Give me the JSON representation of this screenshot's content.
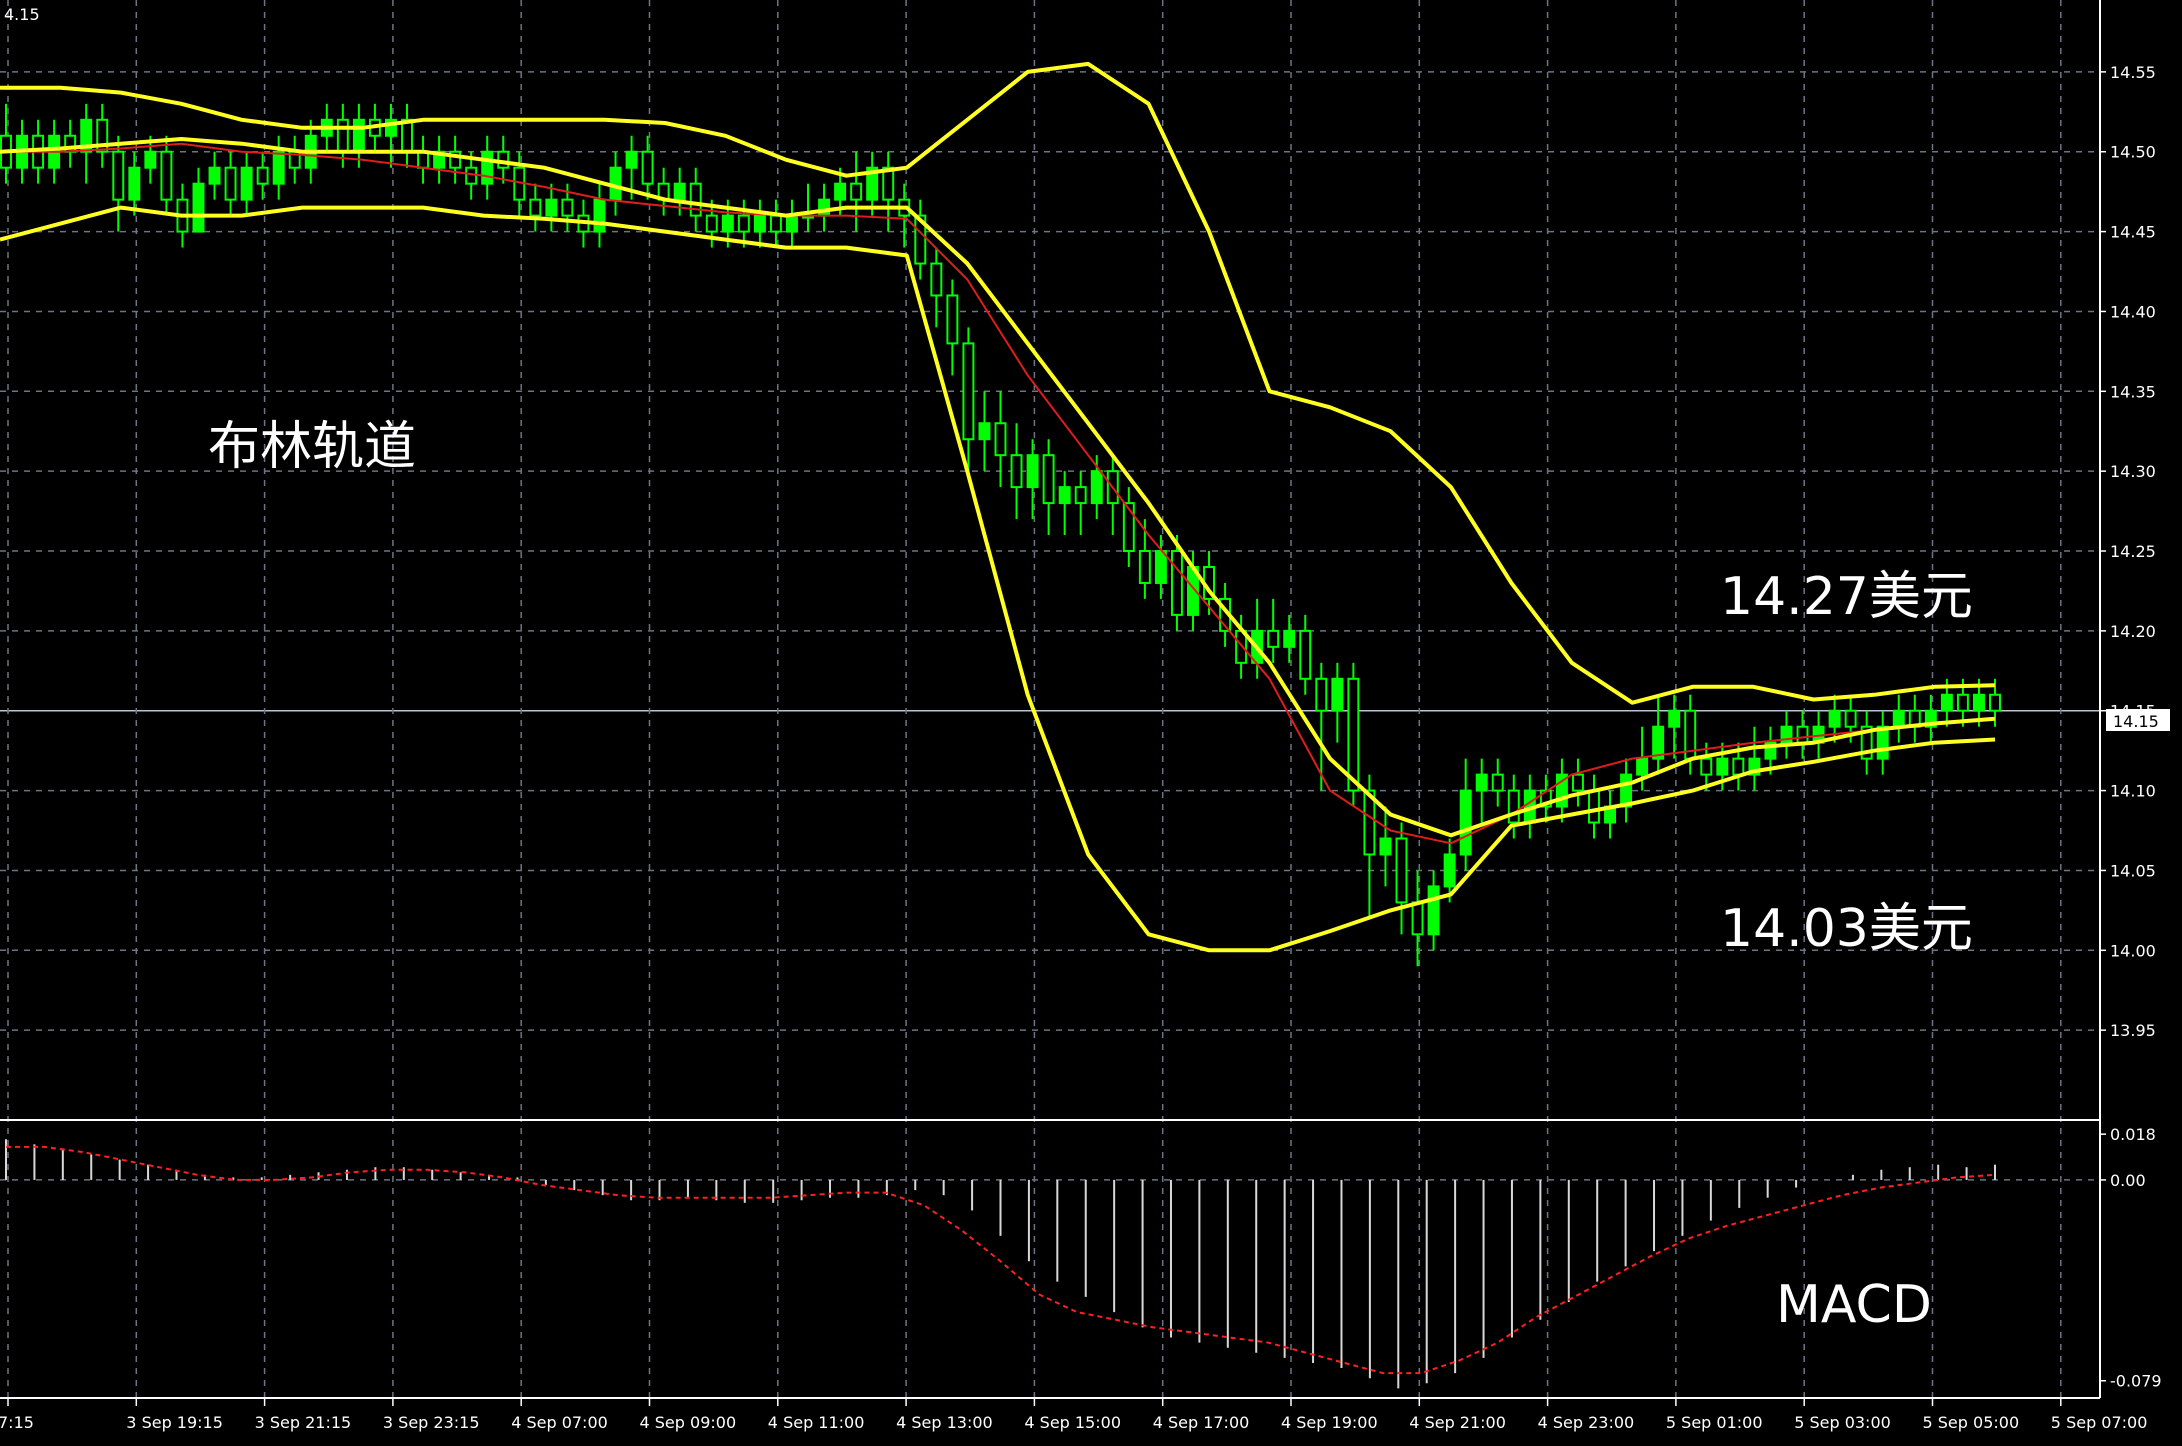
{
  "symbol_price_corner": "4.15",
  "annotations": {
    "indicator_name": "布林轨道",
    "upper_price": "14.27美元",
    "lower_price": "14.03美元",
    "macd_name": "MACD"
  },
  "current_price_label": "14.15",
  "colors": {
    "background": "#000000",
    "grid": "#6b7585",
    "bollinger": "#ffff22",
    "middle_ma": "#e01c1c",
    "bull_candle": "#00ff00",
    "bear_candle": "#000000",
    "axis": "#ffffff",
    "macd_signal": "#ff2020"
  },
  "chart_data": [
    {
      "type": "candlestick",
      "title": "布林轨道",
      "ylim": [
        13.895,
        14.595
      ],
      "y_ticks": [
        "14.55",
        "14.50",
        "14.45",
        "14.40",
        "14.35",
        "14.30",
        "14.25",
        "14.20",
        "14.15",
        "14.10",
        "14.05",
        "14.00",
        "13.95"
      ],
      "x_ticks": [
        "7:15",
        "3 Sep 19:15",
        "3 Sep 21:15",
        "3 Sep 23:15",
        "4 Sep 07:00",
        "4 Sep 09:00",
        "4 Sep 11:00",
        "4 Sep 13:00",
        "4 Sep 15:00",
        "4 Sep 17:00",
        "4 Sep 19:00",
        "4 Sep 21:00",
        "4 Sep 23:00",
        "5 Sep 01:00",
        "5 Sep 03:00",
        "5 Sep 05:00",
        "5 Sep 07:00"
      ],
      "bollinger_upper": [
        14.54,
        14.54,
        14.537,
        14.53,
        14.52,
        14.515,
        14.515,
        14.52,
        14.52,
        14.52,
        14.52,
        14.518,
        14.51,
        14.495,
        14.485,
        14.49,
        14.52,
        14.55,
        14.555,
        14.53,
        14.45,
        14.35,
        14.34,
        14.325,
        14.29,
        14.23,
        14.18,
        14.155,
        14.165,
        14.165,
        14.157,
        14.16,
        14.165,
        14.166
      ],
      "bollinger_middle": [
        14.5,
        14.502,
        14.505,
        14.508,
        14.505,
        14.5,
        14.5,
        14.5,
        14.495,
        14.49,
        14.48,
        14.47,
        14.465,
        14.46,
        14.465,
        14.465,
        14.43,
        14.38,
        14.33,
        14.28,
        14.225,
        14.18,
        14.12,
        14.085,
        14.072,
        14.085,
        14.097,
        14.105,
        14.12,
        14.127,
        14.13,
        14.138,
        14.142,
        14.145
      ],
      "middle_ma": [
        14.5,
        14.5,
        14.502,
        14.505,
        14.5,
        14.498,
        14.495,
        14.49,
        14.485,
        14.478,
        14.47,
        14.466,
        14.462,
        14.46,
        14.46,
        14.458,
        14.42,
        14.36,
        14.31,
        14.26,
        14.215,
        14.17,
        14.1,
        14.075,
        14.067,
        14.085,
        14.11,
        14.12,
        14.125,
        14.13,
        14.134,
        14.138,
        14.142,
        14.145
      ],
      "bollinger_lower": [
        14.445,
        14.455,
        14.465,
        14.46,
        14.46,
        14.465,
        14.465,
        14.465,
        14.46,
        14.458,
        14.455,
        14.45,
        14.445,
        14.44,
        14.44,
        14.435,
        14.3,
        14.16,
        14.06,
        14.01,
        14.0,
        14.0,
        14.012,
        14.025,
        14.035,
        14.078,
        14.085,
        14.092,
        14.1,
        14.112,
        14.118,
        14.125,
        14.13,
        14.132
      ],
      "candles": [
        [
          14.51,
          14.49,
          14.53,
          14.48
        ],
        [
          14.49,
          14.51,
          14.52,
          14.48
        ],
        [
          14.51,
          14.49,
          14.52,
          14.48
        ],
        [
          14.49,
          14.51,
          14.52,
          14.48
        ],
        [
          14.51,
          14.5,
          14.52,
          14.49
        ],
        [
          14.5,
          14.52,
          14.53,
          14.48
        ],
        [
          14.52,
          14.5,
          14.53,
          14.49
        ],
        [
          14.5,
          14.47,
          14.51,
          14.45
        ],
        [
          14.47,
          14.49,
          14.5,
          14.46
        ],
        [
          14.49,
          14.5,
          14.51,
          14.48
        ],
        [
          14.5,
          14.47,
          14.51,
          14.46
        ],
        [
          14.47,
          14.45,
          14.48,
          14.44
        ],
        [
          14.45,
          14.48,
          14.49,
          14.45
        ],
        [
          14.48,
          14.49,
          14.5,
          14.47
        ],
        [
          14.49,
          14.47,
          14.5,
          14.46
        ],
        [
          14.47,
          14.49,
          14.5,
          14.46
        ],
        [
          14.49,
          14.48,
          14.5,
          14.47
        ],
        [
          14.48,
          14.5,
          14.51,
          14.47
        ],
        [
          14.5,
          14.49,
          14.51,
          14.48
        ],
        [
          14.49,
          14.51,
          14.52,
          14.48
        ],
        [
          14.51,
          14.52,
          14.53,
          14.5
        ],
        [
          14.52,
          14.5,
          14.53,
          14.49
        ],
        [
          14.5,
          14.52,
          14.53,
          14.49
        ],
        [
          14.52,
          14.51,
          14.53,
          14.5
        ],
        [
          14.51,
          14.52,
          14.53,
          14.49
        ],
        [
          14.52,
          14.5,
          14.53,
          14.49
        ],
        [
          14.5,
          14.49,
          14.51,
          14.48
        ],
        [
          14.49,
          14.5,
          14.51,
          14.48
        ],
        [
          14.5,
          14.49,
          14.51,
          14.48
        ],
        [
          14.49,
          14.48,
          14.5,
          14.47
        ],
        [
          14.48,
          14.5,
          14.51,
          14.47
        ],
        [
          14.5,
          14.49,
          14.51,
          14.48
        ],
        [
          14.49,
          14.47,
          14.5,
          14.46
        ],
        [
          14.47,
          14.46,
          14.48,
          14.45
        ],
        [
          14.46,
          14.47,
          14.48,
          14.45
        ],
        [
          14.47,
          14.46,
          14.48,
          14.45
        ],
        [
          14.46,
          14.45,
          14.47,
          14.44
        ],
        [
          14.45,
          14.47,
          14.48,
          14.44
        ],
        [
          14.47,
          14.49,
          14.5,
          14.46
        ],
        [
          14.49,
          14.5,
          14.51,
          14.47
        ],
        [
          14.5,
          14.48,
          14.51,
          14.47
        ],
        [
          14.48,
          14.47,
          14.49,
          14.46
        ],
        [
          14.47,
          14.48,
          14.49,
          14.46
        ],
        [
          14.48,
          14.46,
          14.49,
          14.45
        ],
        [
          14.46,
          14.45,
          14.47,
          14.44
        ],
        [
          14.45,
          14.46,
          14.47,
          14.44
        ],
        [
          14.46,
          14.45,
          14.47,
          14.44
        ],
        [
          14.45,
          14.46,
          14.47,
          14.44
        ],
        [
          14.46,
          14.45,
          14.47,
          14.44
        ],
        [
          14.45,
          14.46,
          14.47,
          14.44
        ],
        [
          14.46,
          14.46,
          14.48,
          14.45
        ],
        [
          14.46,
          14.47,
          14.48,
          14.45
        ],
        [
          14.47,
          14.48,
          14.49,
          14.46
        ],
        [
          14.48,
          14.47,
          14.5,
          14.45
        ],
        [
          14.47,
          14.49,
          14.5,
          14.46
        ],
        [
          14.49,
          14.47,
          14.5,
          14.45
        ],
        [
          14.47,
          14.46,
          14.48,
          14.44
        ],
        [
          14.46,
          14.43,
          14.47,
          14.42
        ],
        [
          14.43,
          14.41,
          14.44,
          14.39
        ],
        [
          14.41,
          14.38,
          14.42,
          14.36
        ],
        [
          14.38,
          14.32,
          14.39,
          14.3
        ],
        [
          14.32,
          14.33,
          14.35,
          14.3
        ],
        [
          14.33,
          14.31,
          14.35,
          14.29
        ],
        [
          14.31,
          14.29,
          14.33,
          14.27
        ],
        [
          14.29,
          14.31,
          14.32,
          14.27
        ],
        [
          14.31,
          14.28,
          14.32,
          14.26
        ],
        [
          14.28,
          14.29,
          14.3,
          14.26
        ],
        [
          14.29,
          14.28,
          14.3,
          14.26
        ],
        [
          14.28,
          14.3,
          14.31,
          14.27
        ],
        [
          14.3,
          14.28,
          14.31,
          14.26
        ],
        [
          14.28,
          14.25,
          14.29,
          14.24
        ],
        [
          14.25,
          14.23,
          14.27,
          14.22
        ],
        [
          14.23,
          14.25,
          14.26,
          14.22
        ],
        [
          14.25,
          14.21,
          14.26,
          14.2
        ],
        [
          14.21,
          14.24,
          14.25,
          14.2
        ],
        [
          14.24,
          14.22,
          14.25,
          14.21
        ],
        [
          14.22,
          14.2,
          14.23,
          14.19
        ],
        [
          14.2,
          14.18,
          14.21,
          14.17
        ],
        [
          14.18,
          14.2,
          14.22,
          14.17
        ],
        [
          14.2,
          14.19,
          14.22,
          14.18
        ],
        [
          14.19,
          14.2,
          14.21,
          14.18
        ],
        [
          14.2,
          14.17,
          14.21,
          14.16
        ],
        [
          14.17,
          14.15,
          14.18,
          14.1
        ],
        [
          14.15,
          14.17,
          14.18,
          14.13
        ],
        [
          14.17,
          14.1,
          14.18,
          14.09
        ],
        [
          14.1,
          14.06,
          14.11,
          14.02
        ],
        [
          14.06,
          14.07,
          14.09,
          14.04
        ],
        [
          14.07,
          14.03,
          14.08,
          14.01
        ],
        [
          14.03,
          14.01,
          14.05,
          13.99
        ],
        [
          14.01,
          14.04,
          14.05,
          14.0
        ],
        [
          14.04,
          14.06,
          14.07,
          14.03
        ],
        [
          14.06,
          14.1,
          14.12,
          14.05
        ],
        [
          14.1,
          14.11,
          14.12,
          14.08
        ],
        [
          14.11,
          14.1,
          14.12,
          14.09
        ],
        [
          14.1,
          14.08,
          14.11,
          14.07
        ],
        [
          14.08,
          14.1,
          14.11,
          14.07
        ],
        [
          14.1,
          14.09,
          14.11,
          14.08
        ],
        [
          14.09,
          14.11,
          14.12,
          14.08
        ],
        [
          14.11,
          14.1,
          14.12,
          14.09
        ],
        [
          14.1,
          14.08,
          14.11,
          14.07
        ],
        [
          14.08,
          14.09,
          14.1,
          14.07
        ],
        [
          14.09,
          14.11,
          14.12,
          14.08
        ],
        [
          14.11,
          14.12,
          14.14,
          14.1
        ],
        [
          14.12,
          14.14,
          14.16,
          14.11
        ],
        [
          14.14,
          14.15,
          14.16,
          14.12
        ],
        [
          14.15,
          14.12,
          14.16,
          14.11
        ],
        [
          14.12,
          14.11,
          14.13,
          14.1
        ],
        [
          14.11,
          14.12,
          14.13,
          14.1
        ],
        [
          14.12,
          14.11,
          14.13,
          14.1
        ],
        [
          14.11,
          14.12,
          14.14,
          14.1
        ],
        [
          14.12,
          14.13,
          14.14,
          14.11
        ],
        [
          14.13,
          14.14,
          14.15,
          14.12
        ],
        [
          14.14,
          14.13,
          14.15,
          14.12
        ],
        [
          14.13,
          14.14,
          14.15,
          14.12
        ],
        [
          14.14,
          14.15,
          14.16,
          14.13
        ],
        [
          14.15,
          14.14,
          14.16,
          14.13
        ],
        [
          14.14,
          14.12,
          14.15,
          14.11
        ],
        [
          14.12,
          14.14,
          14.15,
          14.11
        ],
        [
          14.14,
          14.15,
          14.16,
          14.13
        ],
        [
          14.15,
          14.14,
          14.16,
          14.13
        ],
        [
          14.14,
          14.15,
          14.16,
          14.13
        ],
        [
          14.15,
          14.16,
          14.17,
          14.14
        ],
        [
          14.16,
          14.15,
          14.17,
          14.14
        ],
        [
          14.15,
          14.16,
          14.17,
          14.14
        ],
        [
          14.16,
          14.15,
          14.17,
          14.14
        ]
      ]
    },
    {
      "type": "bar",
      "title": "MACD",
      "ylim": [
        -0.085,
        0.022
      ],
      "y_ticks": [
        "0.018",
        "0.00",
        "-0.079"
      ],
      "histogram": [
        0.016,
        0.014,
        0.012,
        0.01,
        0.008,
        0.006,
        0.004,
        0.002,
        0.001,
        0.001,
        0.002,
        0.003,
        0.004,
        0.005,
        0.005,
        0.004,
        0.003,
        0.002,
        0.001,
        -0.002,
        -0.004,
        -0.006,
        -0.008,
        -0.008,
        -0.007,
        -0.008,
        -0.009,
        -0.009,
        -0.008,
        -0.007,
        -0.007,
        -0.006,
        -0.004,
        -0.006,
        -0.012,
        -0.022,
        -0.032,
        -0.04,
        -0.046,
        -0.052,
        -0.058,
        -0.062,
        -0.064,
        -0.066,
        -0.068,
        -0.07,
        -0.072,
        -0.074,
        -0.078,
        -0.082,
        -0.08,
        -0.076,
        -0.07,
        -0.062,
        -0.055,
        -0.048,
        -0.04,
        -0.034,
        -0.028,
        -0.022,
        -0.016,
        -0.011,
        -0.007,
        -0.003,
        0.0,
        0.002,
        0.004,
        0.005,
        0.006,
        0.005,
        0.006
      ],
      "signal": [
        0.013,
        0.013,
        0.011,
        0.008,
        0.005,
        0.002,
        0.0,
        0.0,
        0.001,
        0.003,
        0.004,
        0.004,
        0.003,
        0.001,
        -0.002,
        -0.004,
        -0.006,
        -0.007,
        -0.007,
        -0.007,
        -0.007,
        -0.006,
        -0.005,
        -0.005,
        -0.01,
        -0.02,
        -0.032,
        -0.045,
        -0.052,
        -0.055,
        -0.058,
        -0.06,
        -0.062,
        -0.064,
        -0.068,
        -0.072,
        -0.076,
        -0.076,
        -0.071,
        -0.064,
        -0.054,
        -0.046,
        -0.038,
        -0.03,
        -0.023,
        -0.018,
        -0.014,
        -0.01,
        -0.006,
        -0.003,
        -0.001,
        0.001,
        0.002
      ]
    }
  ]
}
